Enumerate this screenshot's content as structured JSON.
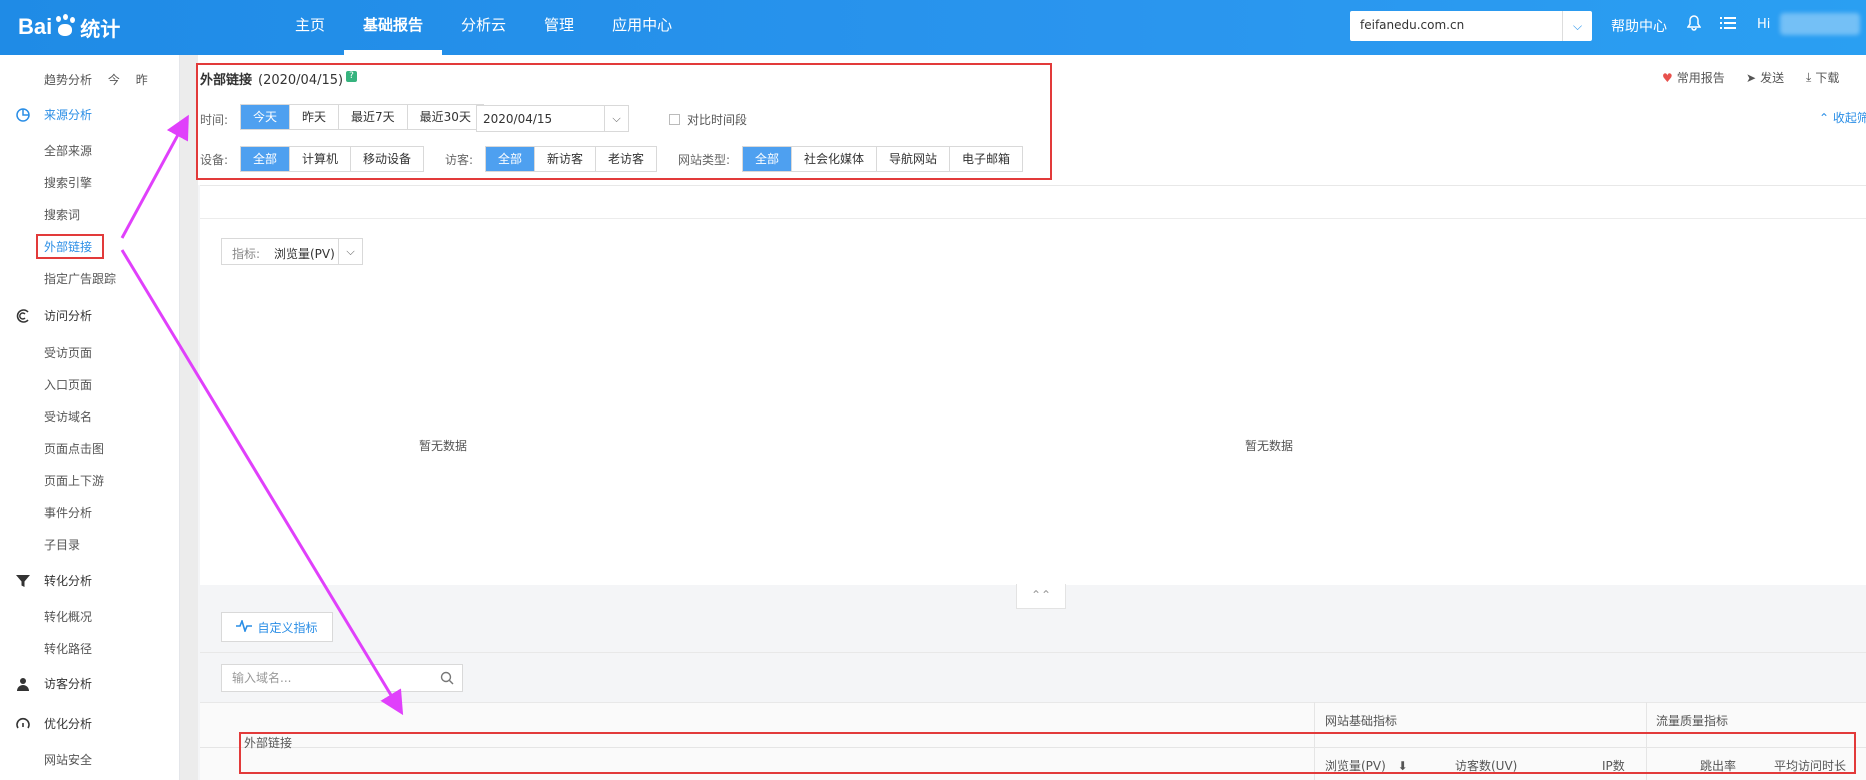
{
  "header": {
    "logo_text": "Bai",
    "logo_mid": "du",
    "logo_cn": "统计",
    "nav": [
      "主页",
      "基础报告",
      "分析云",
      "管理",
      "应用中心"
    ],
    "active_nav": 1,
    "site_value": "feifanedu.com.cn",
    "help_label": "帮助中心",
    "hi_label": "Hi"
  },
  "sidebar": {
    "trend": "趋势分析",
    "trend_today": "今",
    "trend_yesterday": "昨",
    "sections": [
      {
        "label": "来源分析",
        "items": [
          "全部来源",
          "搜索引擎",
          "搜索词",
          "外部链接",
          "指定广告跟踪"
        ]
      },
      {
        "label": "访问分析",
        "items": [
          "受访页面",
          "入口页面",
          "受访域名",
          "页面点击图",
          "页面上下游",
          "事件分析",
          "子目录"
        ]
      },
      {
        "label": "转化分析",
        "items": [
          "转化概况",
          "转化路径"
        ]
      },
      {
        "label": "访客分析",
        "items": []
      },
      {
        "label": "优化分析",
        "items": [
          "网站安全"
        ]
      }
    ]
  },
  "report": {
    "title": "外部链接",
    "date": "(2020/04/15)",
    "help_mark": "?",
    "actions": [
      "常用报告",
      "发送",
      "下载"
    ],
    "collapse": "收起筛",
    "time_label": "时间:",
    "time_options": [
      "今天",
      "昨天",
      "最近7天",
      "最近30天"
    ],
    "date_value": "2020/04/15",
    "compare_label": "对比时间段",
    "device_label": "设备:",
    "device_options": [
      "全部",
      "计算机",
      "移动设备"
    ],
    "visitor_label": "访客:",
    "visitor_options": [
      "全部",
      "新访客",
      "老访客"
    ],
    "site_type_label": "网站类型:",
    "site_type_options": [
      "全部",
      "社会化媒体",
      "导航网站",
      "电子邮箱"
    ]
  },
  "chart": {
    "metric_label": "指标:",
    "metric_value": "浏览量(PV)",
    "no_data": "暂无数据",
    "custom_metric": "自定义指标",
    "search_placeholder": "输入域名..."
  },
  "table": {
    "group_basic": "网站基础指标",
    "group_quality": "流量质量指标",
    "col_source": "外部链接",
    "columns": [
      "浏览量(PV)",
      "访客数(UV)",
      "IP数",
      "跳出率",
      "平均访问时长"
    ]
  },
  "colors": {
    "brand": "#2a95ee",
    "accent_button": "#4ea0f0",
    "annotation": "#e23a3a",
    "arrow": "#e040fb"
  }
}
